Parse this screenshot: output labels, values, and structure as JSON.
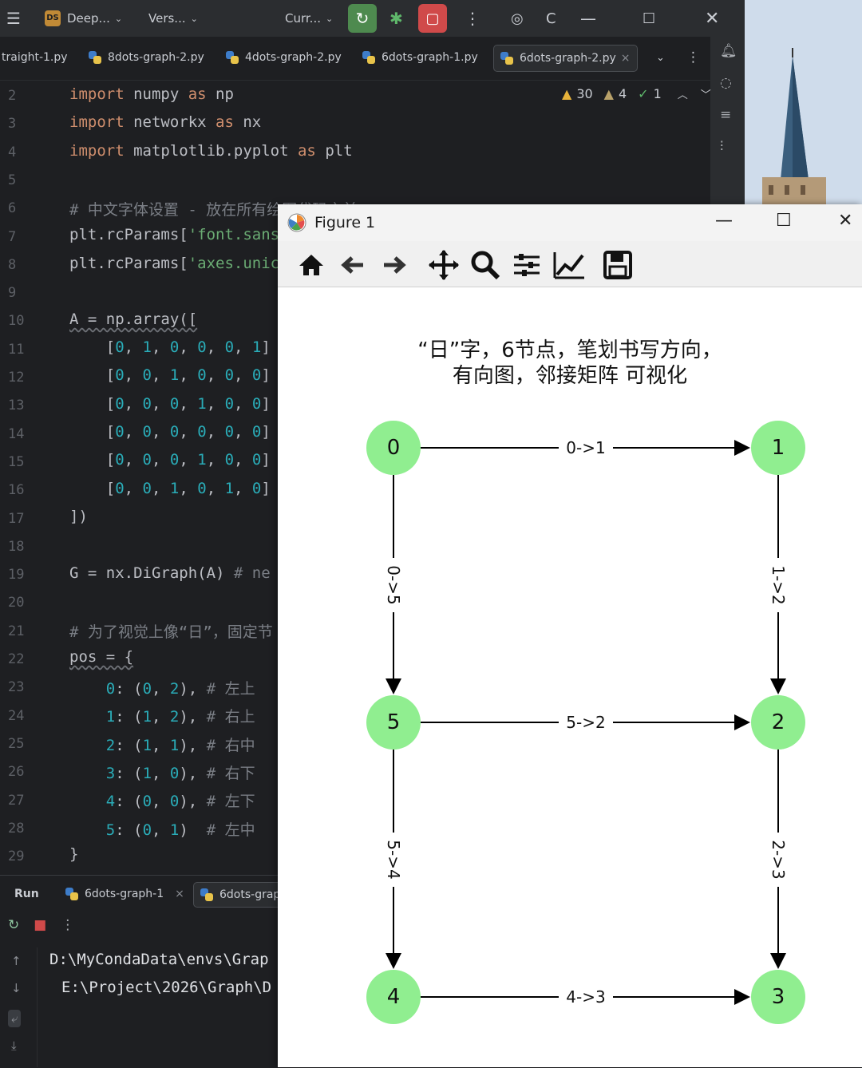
{
  "titlebar": {
    "project": "Deep...",
    "project_badge": "DS",
    "vcs": "Vers...",
    "run_config": "Curr..."
  },
  "editor_tabs": [
    {
      "label": "traight-1.py"
    },
    {
      "label": "8dots-graph-2.py"
    },
    {
      "label": "4dots-graph-2.py"
    },
    {
      "label": "6dots-graph-1.py"
    },
    {
      "label": "6dots-graph-2.py",
      "active": true
    }
  ],
  "inspections": {
    "warnings": "30",
    "weak_warnings": "4",
    "ok": "1"
  },
  "gutter": [
    "2",
    "3",
    "4",
    "5",
    "6",
    "7",
    "8",
    "9",
    "10",
    "11",
    "12",
    "13",
    "14",
    "15",
    "16",
    "17",
    "18",
    "19",
    "20",
    "21",
    "22",
    "23",
    "24",
    "25",
    "26",
    "27",
    "28",
    "29"
  ],
  "code": {
    "l2": [
      "import",
      " numpy ",
      "as",
      " np"
    ],
    "l3": [
      "import",
      " networkx ",
      "as",
      " nx"
    ],
    "l4": [
      "import",
      " matplotlib.pyplot ",
      "as",
      " plt"
    ],
    "l6": "# 中文字体设置 - 放在所有绘图代码之前",
    "l7a": "plt.rcParams[",
    "l7b": "'font.sans",
    "l8a": "plt.rcParams[",
    "l8b": "'axes.unic",
    "l10": "A = np.array([",
    "rows": [
      [
        "0",
        "1",
        "0",
        "0",
        "0",
        "1"
      ],
      [
        "0",
        "0",
        "1",
        "0",
        "0",
        "0"
      ],
      [
        "0",
        "0",
        "0",
        "1",
        "0",
        "0"
      ],
      [
        "0",
        "0",
        "0",
        "0",
        "0",
        "0"
      ],
      [
        "0",
        "0",
        "0",
        "1",
        "0",
        "0"
      ],
      [
        "0",
        "0",
        "1",
        "0",
        "1",
        "0"
      ]
    ],
    "l17": "])",
    "l19a": "G = nx.DiGraph(A)",
    "l19b": " # ne",
    "l21": "# 为了视觉上像“日”，固定节",
    "l22": "pos = {",
    "pos": [
      {
        "k": "0",
        "v": "(0, 2),",
        "c": "# 左上"
      },
      {
        "k": "1",
        "v": "(1, 2),",
        "c": "# 右上"
      },
      {
        "k": "2",
        "v": "(1, 1),",
        "c": "# 右中"
      },
      {
        "k": "3",
        "v": "(1, 0),",
        "c": "# 右下"
      },
      {
        "k": "4",
        "v": "(0, 0),",
        "c": "# 左下"
      },
      {
        "k": "5",
        "v": "(0, 1)",
        "c": " # 左中"
      }
    ],
    "l29": "}"
  },
  "run": {
    "label": "Run",
    "tabs": [
      "6dots-graph-1",
      "6dots-grap"
    ],
    "console": [
      "D:\\MyCondaData\\envs\\Grap",
      "E:\\Project\\2026\\Graph\\D"
    ]
  },
  "figure": {
    "window_title": "Figure 1",
    "title_line1": "“日”字，6节点，笔划书写方向，",
    "title_line2": "有向图，邻接矩阵 可视化",
    "node_color": "#90ee90",
    "edge_color": "#000000"
  },
  "chart_data": {
    "type": "directed-graph",
    "title": "“日”字，6节点，笔划书写方向，有向图，邻接矩阵 可视化",
    "nodes": [
      {
        "id": "0",
        "pos": [
          0,
          2
        ]
      },
      {
        "id": "1",
        "pos": [
          1,
          2
        ]
      },
      {
        "id": "2",
        "pos": [
          1,
          1
        ]
      },
      {
        "id": "3",
        "pos": [
          1,
          0
        ]
      },
      {
        "id": "4",
        "pos": [
          0,
          0
        ]
      },
      {
        "id": "5",
        "pos": [
          0,
          1
        ]
      }
    ],
    "edges": [
      {
        "from": "0",
        "to": "1",
        "label": "0->1"
      },
      {
        "from": "0",
        "to": "5",
        "label": "0->5"
      },
      {
        "from": "1",
        "to": "2",
        "label": "1->2"
      },
      {
        "from": "2",
        "to": "3",
        "label": "2->3"
      },
      {
        "from": "4",
        "to": "3",
        "label": "4->3"
      },
      {
        "from": "5",
        "to": "2",
        "label": "5->2"
      },
      {
        "from": "5",
        "to": "4",
        "label": "5->4"
      }
    ],
    "xlim": [
      0,
      1
    ],
    "ylim": [
      0,
      2
    ]
  }
}
